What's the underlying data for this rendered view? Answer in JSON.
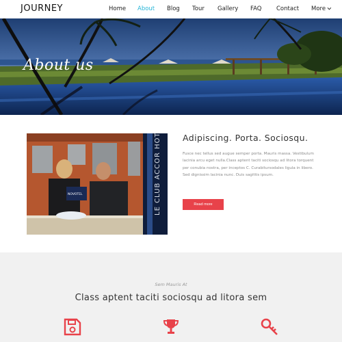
{
  "header": {
    "logo": "JOURNEY",
    "nav": [
      {
        "label": "Home",
        "active": false
      },
      {
        "label": "About",
        "active": true
      },
      {
        "label": "Blog",
        "active": false
      },
      {
        "label": "Tour",
        "active": false
      },
      {
        "label": "Gallery",
        "active": false
      },
      {
        "label": "FAQ",
        "active": false
      },
      {
        "label": "Contact",
        "active": false
      },
      {
        "label": "More",
        "active": false
      }
    ]
  },
  "hero": {
    "title": "About us"
  },
  "about": {
    "heading": "Adipiscing. Porta. Sociosqu.",
    "body": "Fusce nec tellus sed augue semper porta. Mauris massa. Vestibulum lacinia arcu eget nulla.Class aptent taciti sociosqu ad litora torquent per conubia nostra, per inceptos C. Curabitursodales ligula in libero. Sed dignissim lacinia nunc. Duis sagittis ipsum.",
    "button_label": "Read more",
    "photo_sign_text": "LE CLUB ACCOR HOTELS",
    "photo_card_text": "NOVOTEL"
  },
  "features": {
    "kicker": "Sem Mauris At",
    "title": "Class aptent taciti sociosqu ad litora sem",
    "icons": [
      "save-icon",
      "trophy-icon",
      "key-icon"
    ]
  },
  "colors": {
    "accent": "#e8424a",
    "nav_active": "#29b6d8",
    "section_bg": "#f1f1f1"
  }
}
